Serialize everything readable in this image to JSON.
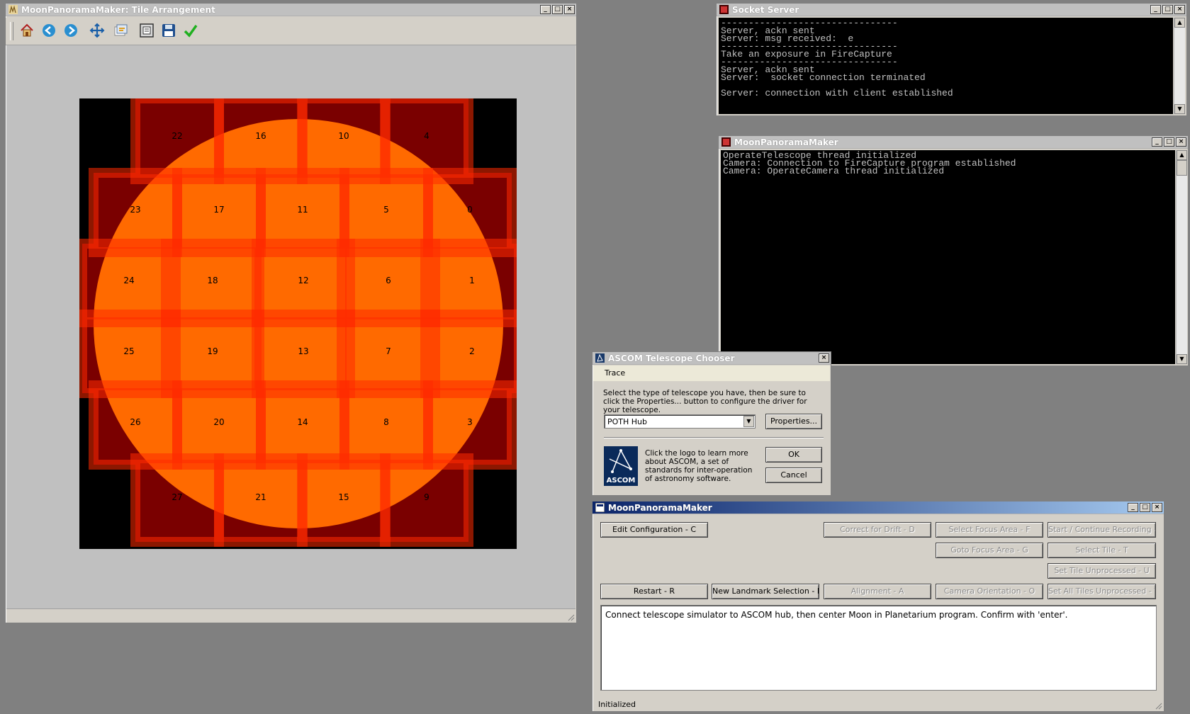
{
  "tile_window": {
    "title": "MoonPanoramaMaker: Tile Arrangement",
    "toolbar_icons": [
      "home-icon",
      "back-arrow-icon",
      "forward-arrow-icon",
      "pan-move-icon",
      "configure-subplots-icon",
      "zoom-rect-icon",
      "save-icon",
      "check-icon"
    ],
    "tiles": [
      {
        "label": "22"
      },
      {
        "label": "16"
      },
      {
        "label": "10"
      },
      {
        "label": "4"
      },
      {
        "label": "23"
      },
      {
        "label": "17"
      },
      {
        "label": "11"
      },
      {
        "label": "5"
      },
      {
        "label": "0"
      },
      {
        "label": "24"
      },
      {
        "label": "18"
      },
      {
        "label": "12"
      },
      {
        "label": "6"
      },
      {
        "label": "1"
      },
      {
        "label": "25"
      },
      {
        "label": "19"
      },
      {
        "label": "13"
      },
      {
        "label": "7"
      },
      {
        "label": "2"
      },
      {
        "label": "26"
      },
      {
        "label": "20"
      },
      {
        "label": "14"
      },
      {
        "label": "8"
      },
      {
        "label": "3"
      },
      {
        "label": "27"
      },
      {
        "label": "21"
      },
      {
        "label": "15"
      },
      {
        "label": "9"
      }
    ],
    "colors": {
      "moon": "#ff6a00",
      "tile_outside": "#7a0000",
      "overlap": "#ff2a00",
      "background": "#000000"
    }
  },
  "socket_server": {
    "title": "Socket Server",
    "text": "--------------------------------\nServer, ackn sent\nServer: msg received:  e\n--------------------------------\nTake an exposure in FireCapture\n--------------------------------\nServer, ackn sent\nServer:  socket connection terminated\n\nServer: connection with client established"
  },
  "console_window": {
    "title": "MoonPanoramaMaker",
    "text": "OperateTelescope thread initialized\nCamera: Connection to FireCapture program established\nCamera: OperateCamera thread initialized"
  },
  "ascom": {
    "title": "ASCOM Telescope Chooser",
    "menu_trace": "Trace",
    "instructions": "Select the type of telescope you have, then be sure to click the Properties... button to configure the driver for your telescope.",
    "selected": "POTH Hub",
    "properties_label": "Properties...",
    "logo_text": "ASCOM",
    "about_text": "Click the logo to learn more about ASCOM, a set of standards for inter-operation of astronomy software.",
    "ok_label": "OK",
    "cancel_label": "Cancel"
  },
  "main_window": {
    "title": "MoonPanoramaMaker",
    "buttons": {
      "edit_config": "Edit Configuration - C",
      "correct_drift": "Correct for Drift - D",
      "select_focus": "Select Focus Area - F",
      "start_recording": "Start / Continue Recording - S",
      "goto_focus": "Goto Focus Area - G",
      "select_tile": "Select Tile - T",
      "set_tile_unprocessed": "Set Tile Unprocessed - U",
      "restart": "Restart - R",
      "new_landmark": "New Landmark Selection - L",
      "alignment": "Alignment - A",
      "camera_orientation": "Camera Orientation - O",
      "set_all_unprocessed": "Set All Tiles Unprocessed - V"
    },
    "message": "Connect telescope simulator to ASCOM hub, then center Moon in Planetarium program. Confirm with 'enter'.",
    "status": "Initialized"
  }
}
